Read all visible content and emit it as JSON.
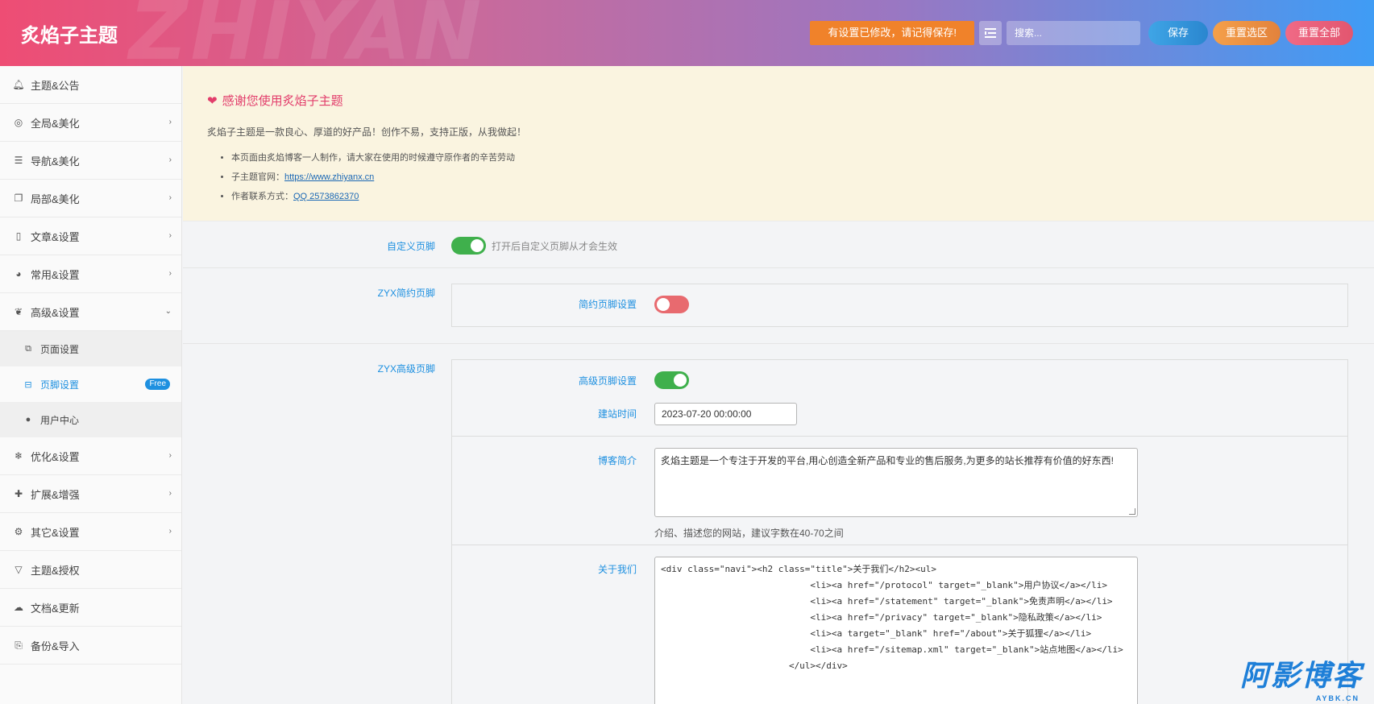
{
  "header": {
    "brand": "炙焰子主题",
    "watermark": "ZHIYAN",
    "notice": "有设置已修改，请记得保存!",
    "search_placeholder": "搜索...",
    "save": "保存",
    "reset_selected": "重置选区",
    "reset_all": "重置全部"
  },
  "sidebar": {
    "items": [
      {
        "label": "主题&公告",
        "icon": "bell-icon"
      },
      {
        "label": "全局&美化",
        "icon": "target-icon"
      },
      {
        "label": "导航&美化",
        "icon": "list-icon"
      },
      {
        "label": "局部&美化",
        "icon": "copy-icon"
      },
      {
        "label": "文章&设置",
        "icon": "map-icon"
      },
      {
        "label": "常用&设置",
        "icon": "pie-chart-icon"
      },
      {
        "label": "高级&设置",
        "icon": "leaf-icon"
      }
    ],
    "subitems": [
      {
        "label": "页面设置",
        "icon": "windows-icon"
      },
      {
        "label": "页脚设置",
        "icon": "minus-square-icon",
        "badge": "Free"
      },
      {
        "label": "用户中心",
        "icon": "user-icon"
      }
    ],
    "items_after": [
      {
        "label": "优化&设置",
        "icon": "snowflake-icon"
      },
      {
        "label": "扩展&增强",
        "icon": "puzzle-icon"
      },
      {
        "label": "其它&设置",
        "icon": "gear-icon"
      },
      {
        "label": "主题&授权",
        "icon": "vuejs-icon"
      },
      {
        "label": "文档&更新",
        "icon": "cloud-download-icon"
      },
      {
        "label": "备份&导入",
        "icon": "clone-icon"
      }
    ]
  },
  "welcome": {
    "title": "感谢您使用炙焰子主题",
    "intro": "炙焰子主题是一款良心、厚道的好产品！创作不易，支持正版，从我做起！",
    "line1": "本页面由炙焰博客一人制作，请大家在使用的时候遵守原作者的辛苦劳动",
    "line2_prefix": "子主题官网：",
    "line2_link": "https://www.zhiyanx.cn",
    "line3_prefix": "作者联系方式：",
    "line3_link": "QQ 2573862370"
  },
  "custom_footer": {
    "label": "自定义页脚",
    "enabled": true,
    "desc": "打开后自定义页脚从才会生效"
  },
  "simple_footer": {
    "label": "ZYX简约页脚",
    "setting_label": "简约页脚设置",
    "enabled": false
  },
  "advanced_footer": {
    "label": "ZYX高级页脚",
    "setting_label": "高级页脚设置",
    "enabled": true,
    "site_time_label": "建站时间",
    "site_time_value": "2023-07-20 00:00:00",
    "blog_intro_label": "博客简介",
    "blog_intro_value": "炙焰主题是一个专注于开发的平台,用心创造全新产品和专业的售后服务,为更多的站长推荐有价值的好东西!",
    "blog_intro_hint": "介绍、描述您的网站，建议字数在40-70之间",
    "about_label": "关于我们",
    "about_code": "<div class=\"navi\"><h2 class=\"title\">关于我们</h2><ul>\n                            <li><a href=\"/protocol\" target=\"_blank\">用户协议</a></li>\n                            <li><a href=\"/statement\" target=\"_blank\">免责声明</a></li>\n                            <li><a href=\"/privacy\" target=\"_blank\">隐私政策</a></li>\n                            <li><a target=\"_blank\" href=\"/about\">关于狐狸</a></li>\n                            <li><a href=\"/sitemap.xml\" target=\"_blank\">站点地图</a></li>\n                        </ul></div>"
  },
  "corner_watermark": {
    "text": "阿影博客",
    "sub": "AYBK.CN"
  }
}
